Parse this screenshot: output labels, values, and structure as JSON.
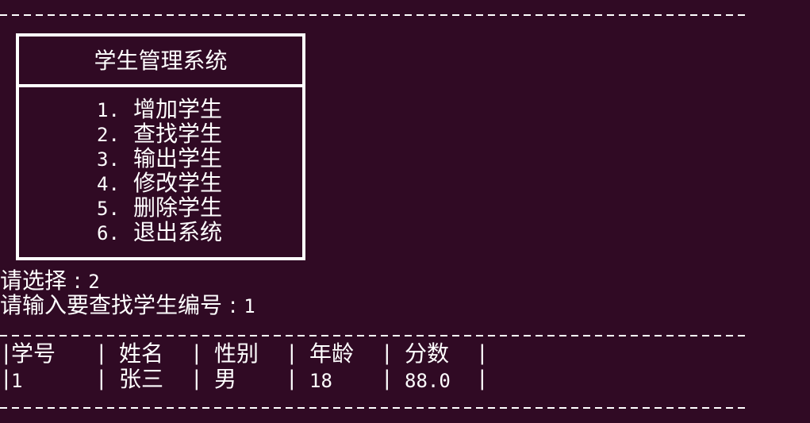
{
  "menu": {
    "title": "学生管理系统",
    "items": [
      {
        "num": "1.",
        "label": "增加学生"
      },
      {
        "num": "2.",
        "label": "查找学生"
      },
      {
        "num": "3.",
        "label": "输出学生"
      },
      {
        "num": "4.",
        "label": "修改学生"
      },
      {
        "num": "5.",
        "label": "删除学生"
      },
      {
        "num": "6.",
        "label": "退出系统"
      }
    ]
  },
  "prompts": {
    "choice_label": "请选择 : ",
    "choice_value": "2",
    "id_label": "请输入要查找学生编号 : ",
    "id_value": "1"
  },
  "table": {
    "headers": [
      "学号",
      "姓名",
      "性别",
      "年龄",
      "分数"
    ],
    "rows": [
      [
        "1",
        "张三",
        "男",
        "18",
        "88.0"
      ]
    ]
  },
  "colors": {
    "background": "#300a24",
    "foreground": "#ffffff"
  }
}
